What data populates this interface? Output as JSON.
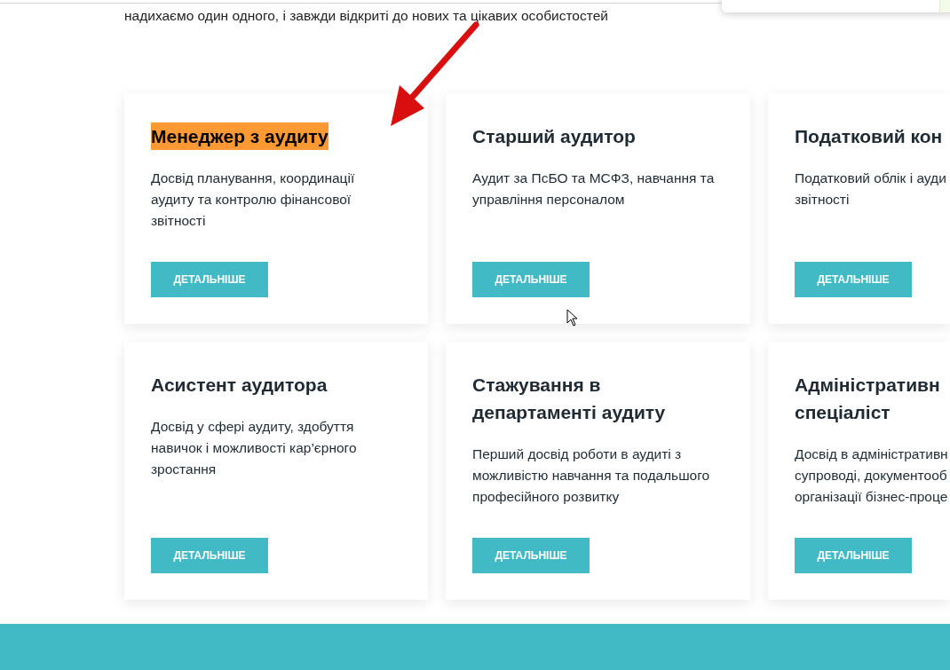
{
  "intro": "надихаємо один одного, і завжди відкриті до нових та цікавих особистостей",
  "cards": [
    {
      "title": [
        "Менеджер з аудиту"
      ],
      "highlighted": true,
      "description": [
        "Досвід планування, координації",
        "аудиту та контролю фінансової",
        "звітності"
      ],
      "button": "ДЕТАЛЬНІШЕ"
    },
    {
      "title": [
        "Старший аудитор"
      ],
      "highlighted": false,
      "description": [
        "Аудит за ПсБО та МСФЗ, навчання та",
        "управління персоналом"
      ],
      "button": "ДЕТАЛЬНІШЕ"
    },
    {
      "title": [
        "Податковий кон"
      ],
      "highlighted": false,
      "description": [
        "Податковий облік і ауди",
        "звітності"
      ],
      "button": "ДЕТАЛЬНІШЕ"
    },
    {
      "title": [
        "Асистент аудитора"
      ],
      "highlighted": false,
      "description": [
        "Досвід у сфері аудиту, здобуття",
        "навичок і можливості кар’єрного",
        "зростання"
      ],
      "button": "ДЕТАЛЬНІШЕ"
    },
    {
      "title": [
        "Стажування в",
        "департаменті аудиту"
      ],
      "highlighted": false,
      "description": [
        "Перший досвід роботи в аудиті з",
        "можливістю навчання та подальшого",
        "професійного розвитку"
      ],
      "button": "ДЕТАЛЬНІШЕ"
    },
    {
      "title": [
        "Адміністративн",
        "спеціаліст"
      ],
      "highlighted": false,
      "description": [
        "Досвід в адміністративн",
        "супроводі, документооб",
        "організації бізнес-проце"
      ],
      "button": "ДЕТАЛЬНІШЕ"
    }
  ]
}
